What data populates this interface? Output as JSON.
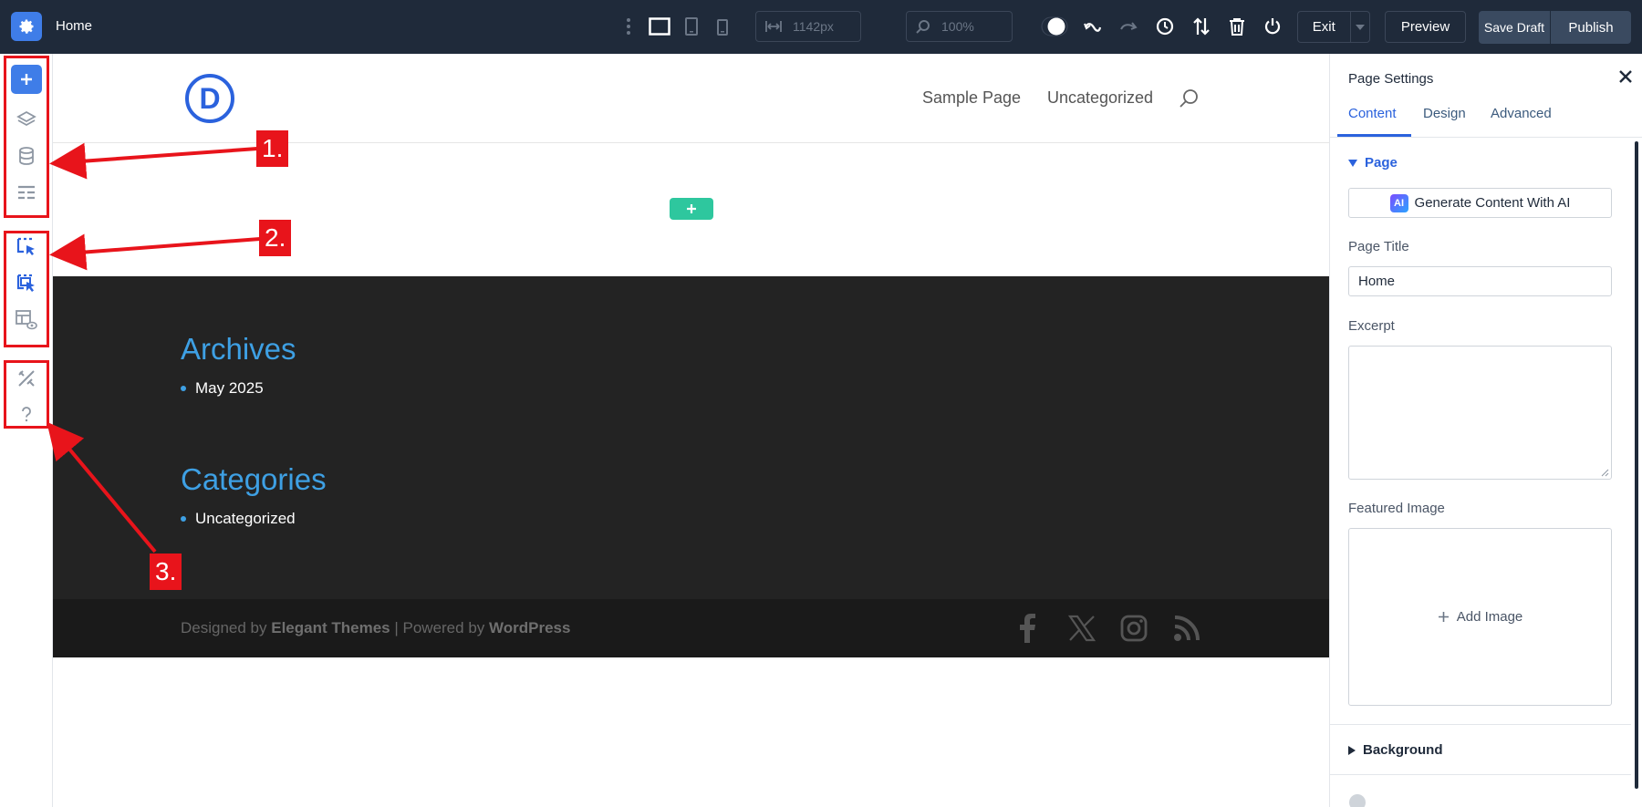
{
  "topbar": {
    "page_name": "Home",
    "width_value": "1142px",
    "zoom_value": "100%",
    "exit_label": "Exit",
    "preview_label": "Preview",
    "save_draft_label": "Save Draft",
    "publish_label": "Publish"
  },
  "annotations": {
    "label_1": "1.",
    "label_2": "2.",
    "label_3": "3."
  },
  "site": {
    "logo_letter": "D",
    "nav": [
      "Sample Page",
      "Uncategorized"
    ],
    "widgets": [
      {
        "title": "Archives",
        "items": [
          "May 2025"
        ]
      },
      {
        "title": "Categories",
        "items": [
          "Uncategorized"
        ]
      }
    ],
    "credits": {
      "designed_by": "Designed by",
      "theme_author": "Elegant Themes",
      "separator": "| Powered by",
      "platform": "WordPress"
    }
  },
  "panel": {
    "title": "Page Settings",
    "tabs": [
      "Content",
      "Design",
      "Advanced"
    ],
    "active_tab": "Content",
    "section_page": "Page",
    "ai_button_label": "Generate Content With AI",
    "ai_badge": "AI",
    "page_title_label": "Page Title",
    "page_title_value": "Home",
    "excerpt_label": "Excerpt",
    "featured_image_label": "Featured Image",
    "add_image_label": "Add Image",
    "section_background": "Background"
  },
  "colors": {
    "topbar_bg": "#1f2a3a",
    "accent": "#2b62dd",
    "annotation_red": "#e8141b",
    "widget_title": "#3ea0e4",
    "add_section_green": "#2ec79e"
  }
}
